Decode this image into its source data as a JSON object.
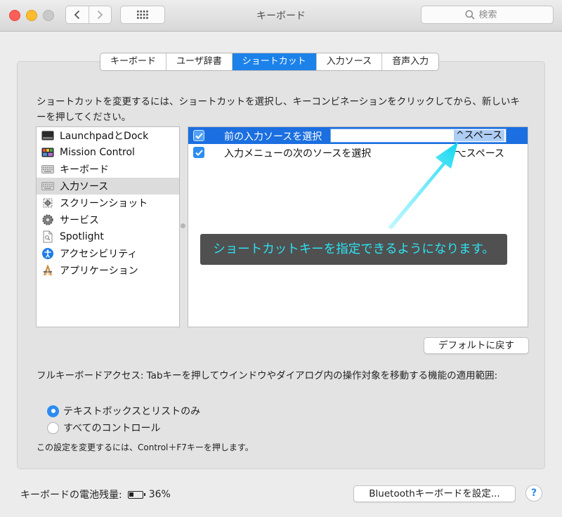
{
  "window": {
    "title": "キーボード"
  },
  "toolbar": {
    "search_placeholder": "検索"
  },
  "tabs": [
    {
      "label": "キーボード",
      "active": false
    },
    {
      "label": "ユーザ辞書",
      "active": false
    },
    {
      "label": "ショートカット",
      "active": true
    },
    {
      "label": "入力ソース",
      "active": false
    },
    {
      "label": "音声入力",
      "active": false
    }
  ],
  "description": "ショートカットを変更するには、ショートカットを選択し、キーコンビネーションをクリックしてから、新しいキーを押してください。",
  "categories": [
    {
      "label": "LaunchpadとDock",
      "icon": "dock-icon",
      "selected": false
    },
    {
      "label": "Mission Control",
      "icon": "mission-control-icon",
      "selected": false
    },
    {
      "label": "キーボード",
      "icon": "keyboard-icon",
      "selected": false
    },
    {
      "label": "入力ソース",
      "icon": "keyboard-icon",
      "selected": true
    },
    {
      "label": "スクリーンショット",
      "icon": "screenshot-icon",
      "selected": false
    },
    {
      "label": "サービス",
      "icon": "gear-icon",
      "selected": false
    },
    {
      "label": "Spotlight",
      "icon": "document-icon",
      "selected": false
    },
    {
      "label": "アクセシビリティ",
      "icon": "accessibility-icon",
      "selected": false
    },
    {
      "label": "アプリケーション",
      "icon": "app-store-icon",
      "selected": false
    }
  ],
  "shortcuts": [
    {
      "label": "前の入力ソースを選択",
      "key": "^スペース",
      "checked": true,
      "selected": true,
      "editing": true
    },
    {
      "label": "入力メニューの次のソースを選択",
      "key": "^⌥スペース",
      "checked": true,
      "selected": false,
      "editing": false
    }
  ],
  "annotation": {
    "text": "ショートカットキーを指定できるようになります。",
    "color": "#2de2f2"
  },
  "buttons": {
    "restore_defaults": "デフォルトに戻す",
    "bluetooth_setup": "Bluetoothキーボードを設定...",
    "help": "?"
  },
  "full_keyboard_access": {
    "text": "フルキーボードアクセス: Tabキーを押してウインドウやダイアログ内の操作対象を移動する機能の適用範囲:",
    "options": [
      {
        "label": "テキストボックスとリストのみ",
        "selected": true
      },
      {
        "label": "すべてのコントロール",
        "selected": false
      }
    ],
    "note": "この設定を変更するには、Control＋F7キーを押します。"
  },
  "battery": {
    "label": "キーボードの電池残量:",
    "value": "36%",
    "level": 0.36
  },
  "colors": {
    "accent": "#1c82ea",
    "selection": "#1b6fe0",
    "annotation_bg": "#505050"
  }
}
